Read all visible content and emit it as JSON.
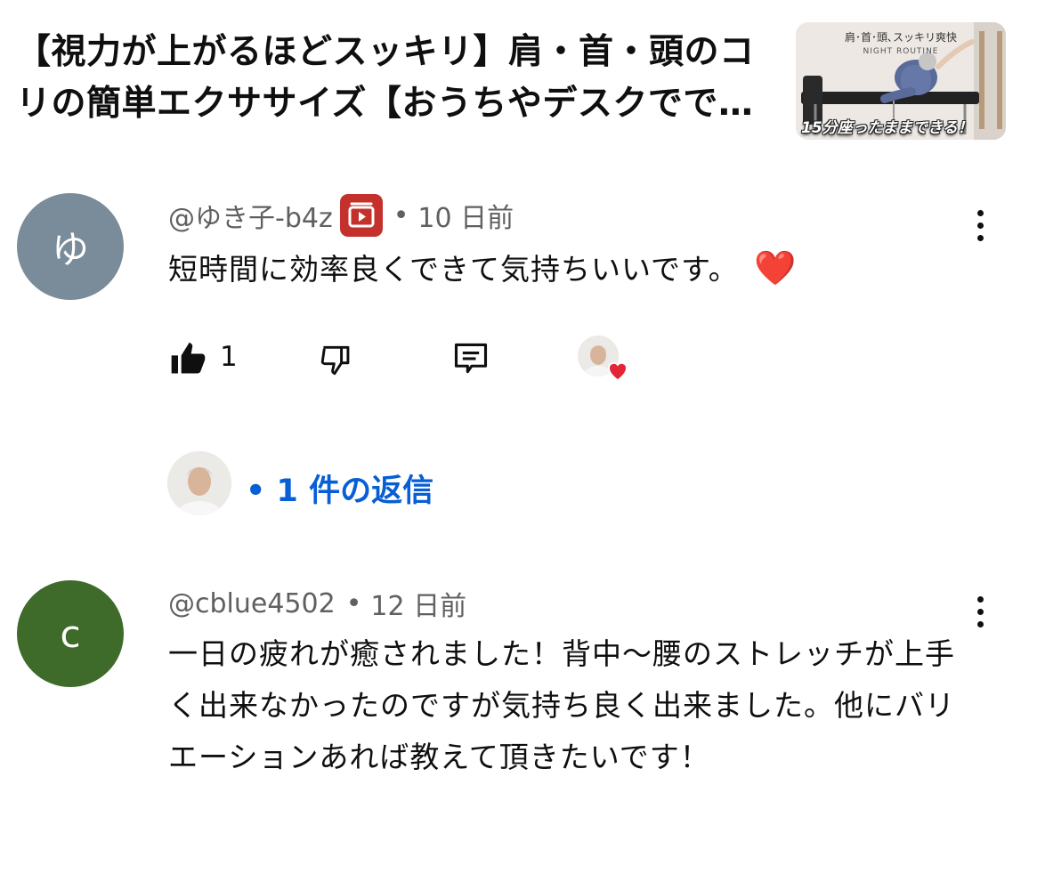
{
  "video": {
    "title": "【視力が上がるほどスッキリ】肩・首・頭のコリの簡単エクササイズ【おうちやデスクでできるストレッチ】",
    "thumbnail": {
      "top_text": "肩･首･頭､スッキリ爽快",
      "sub_text": "NIGHT ROUTINE",
      "bottom_text": "15分座ったままできる！"
    }
  },
  "comments": [
    {
      "avatar_letter": "ゆ",
      "avatar_color": "#7a8c99",
      "handle": "@ゆき子-b4z",
      "member_badge_icon": "member-badge-icon",
      "separator": "•",
      "time": "10 日前",
      "text": "短時間に効率良くできて気持ちいいです。",
      "emoji": "❤️",
      "like_count": "1",
      "creator_hearted": true,
      "replies_label": "• 1 件の返信"
    },
    {
      "avatar_letter": "c",
      "avatar_color": "#3f6b2a",
      "handle": "@cblue4502",
      "separator": "•",
      "time": "12 日前",
      "text": "一日の疲れが癒されました！背中〜腰のストレッチが上手く出来なかったのですが気持ち良く出来ました。他にバリエーションあれば教えて頂きたいです！"
    }
  ],
  "colors": {
    "link": "#065fd4",
    "heart": "#e32636",
    "badge": "#c4302b"
  }
}
